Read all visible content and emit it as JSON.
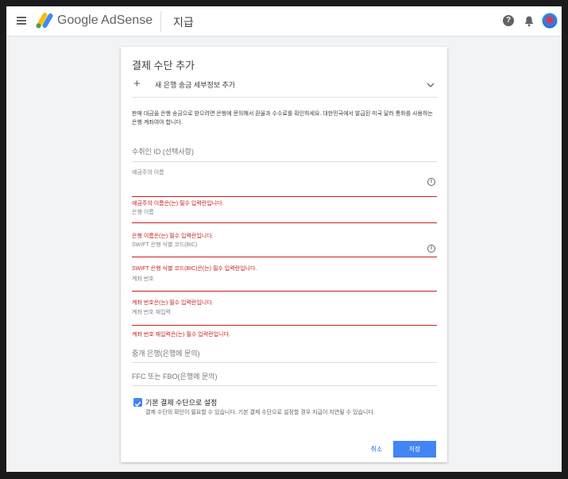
{
  "header": {
    "product_name": "Google AdSense",
    "page_title": "지급",
    "help_icon": "help-circle-icon",
    "bell_icon": "notifications-bell-icon",
    "logo_colors": [
      "#fbbc04",
      "#4285f4",
      "#34a853"
    ]
  },
  "form": {
    "title": "결제 수단 추가",
    "add_option": "새 은행 송금 세부정보 추가",
    "notice": "판매 대금을 은행 송금으로 받으려면 은행에 문의해서 환율과 수수료를 확인하세요. 대한민국에서 발급된 미국 달러 통화를 사용하는 은행 계좌여야 합니다.",
    "payee_id_placeholder": "수취인 ID (선택사항)",
    "fields": [
      {
        "label": "예금주의 이름",
        "value": "",
        "error": "예금주의 이름은(는) 필수 입력란입니다."
      },
      {
        "label": "은행 이름",
        "value": "",
        "error": "은행 이름은(는) 필수 입력란입니다."
      },
      {
        "label": "SWIFT 은행 식별 코드(BIC)",
        "value": "",
        "error": "SWIFT 은행 식별 코드(BIC)은(는) 필수 입력란입니다."
      },
      {
        "label": "계좌 번호",
        "value": "",
        "error": "계좌 번호은(는) 필수 입력란입니다."
      },
      {
        "label": "계좌 번호 재입력",
        "value": "",
        "error": "계좌 번호 재입력은(는) 필수 입력란입니다."
      }
    ],
    "intermediary_bank_placeholder": "중개 은행(은행에 문의)",
    "ffc_placeholder": "FFC 또는 FBO(은행에 문의)",
    "default_checkbox": {
      "checked": true,
      "label": "기본 결제 수단으로 설정",
      "description": "결제 수단의 확인이 필요할 수 있습니다. 기본 결제 수단으로 설정할 경우 지급이 지연될 수 있습니다."
    },
    "cancel_label": "취소",
    "save_label": "저장",
    "accent_color": "#4285f4",
    "error_color": "#c5221f"
  }
}
